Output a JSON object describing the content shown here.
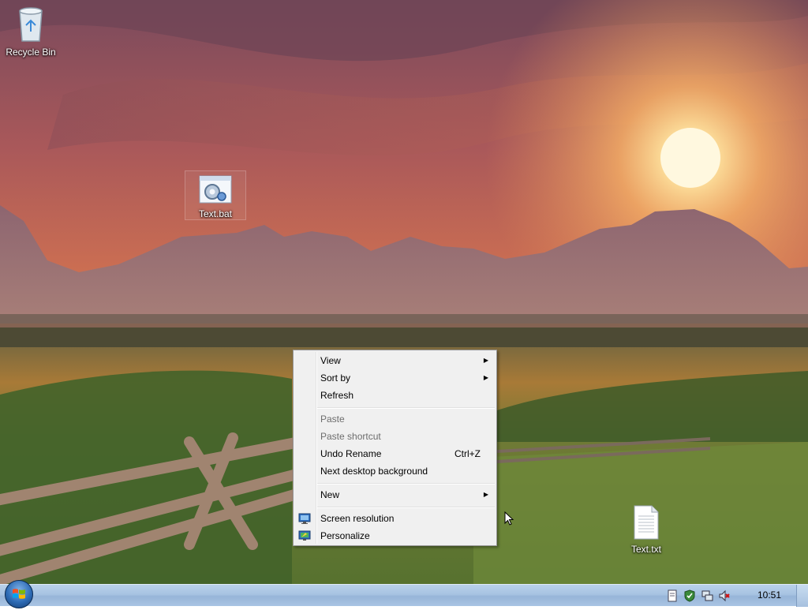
{
  "desktop": {
    "icons": [
      {
        "label": "Recycle Bin",
        "icon": "recycle-bin-icon"
      },
      {
        "label": "Text.bat",
        "icon": "batch-file-icon"
      },
      {
        "label": "Text.txt",
        "icon": "text-file-icon"
      }
    ]
  },
  "context_menu": {
    "items": [
      {
        "label": "View",
        "has_submenu": true,
        "enabled": true
      },
      {
        "label": "Sort by",
        "has_submenu": true,
        "enabled": true
      },
      {
        "label": "Refresh",
        "enabled": true
      },
      {
        "label": "Paste",
        "enabled": false
      },
      {
        "label": "Paste shortcut",
        "enabled": false
      },
      {
        "label": "Undo Rename",
        "shortcut": "Ctrl+Z",
        "enabled": true
      },
      {
        "label": "Next desktop background",
        "enabled": true
      },
      {
        "label": "New",
        "has_submenu": true,
        "enabled": true
      },
      {
        "label": "Screen resolution",
        "icon": "screen-resolution-icon",
        "enabled": true
      },
      {
        "label": "Personalize",
        "icon": "personalize-icon",
        "enabled": true
      }
    ]
  },
  "taskbar": {
    "start_icon": "windows-logo-icon",
    "tray_icons": [
      "action-center-icon",
      "security-shield-icon",
      "network-icon",
      "volume-muted-icon"
    ],
    "clock": "10:51"
  },
  "colors": {
    "taskbar": "#a7c3e2",
    "menu_background": "#f0f0f0",
    "menu_border": "#979797"
  }
}
